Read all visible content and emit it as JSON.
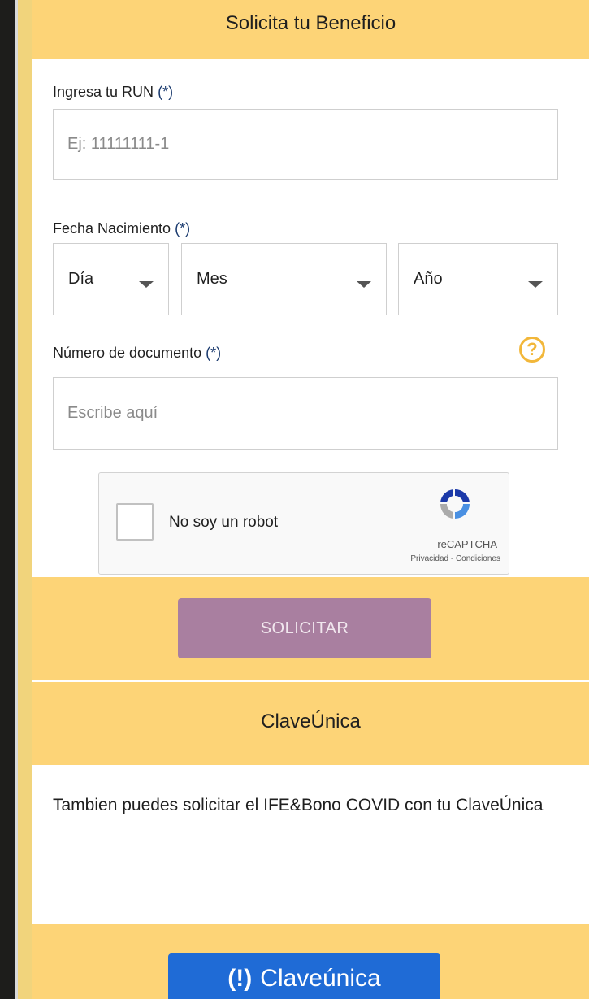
{
  "header": {
    "title": "Solicita tu Beneficio"
  },
  "form": {
    "run_label": "Ingresa tu RUN",
    "required_mark": "(*)",
    "run_placeholder": "Ej: 11111111-1",
    "birth_label": "Fecha Nacimiento",
    "day_value": "Día",
    "month_value": "Mes",
    "year_value": "Año",
    "doc_label": "Número de documento",
    "doc_placeholder": "Escribe aquí",
    "help_glyph": "?"
  },
  "captcha": {
    "text": "No soy un robot",
    "brand": "reCAPTCHA",
    "links": "Privacidad - Condiciones"
  },
  "submit": {
    "label": "SOLICITAR"
  },
  "clave": {
    "title": "ClaveÚnica",
    "description": "Tambien puedes solicitar el IFE&Bono COVID con tu ClaveÚnica",
    "button_label": "Claveúnica"
  },
  "colors": {
    "band": "#fdd477",
    "page_bg": "#f1d47c",
    "submit_button": "#a97fa0",
    "clave_button": "#1f6bd6",
    "help_icon": "#f2b73a"
  }
}
